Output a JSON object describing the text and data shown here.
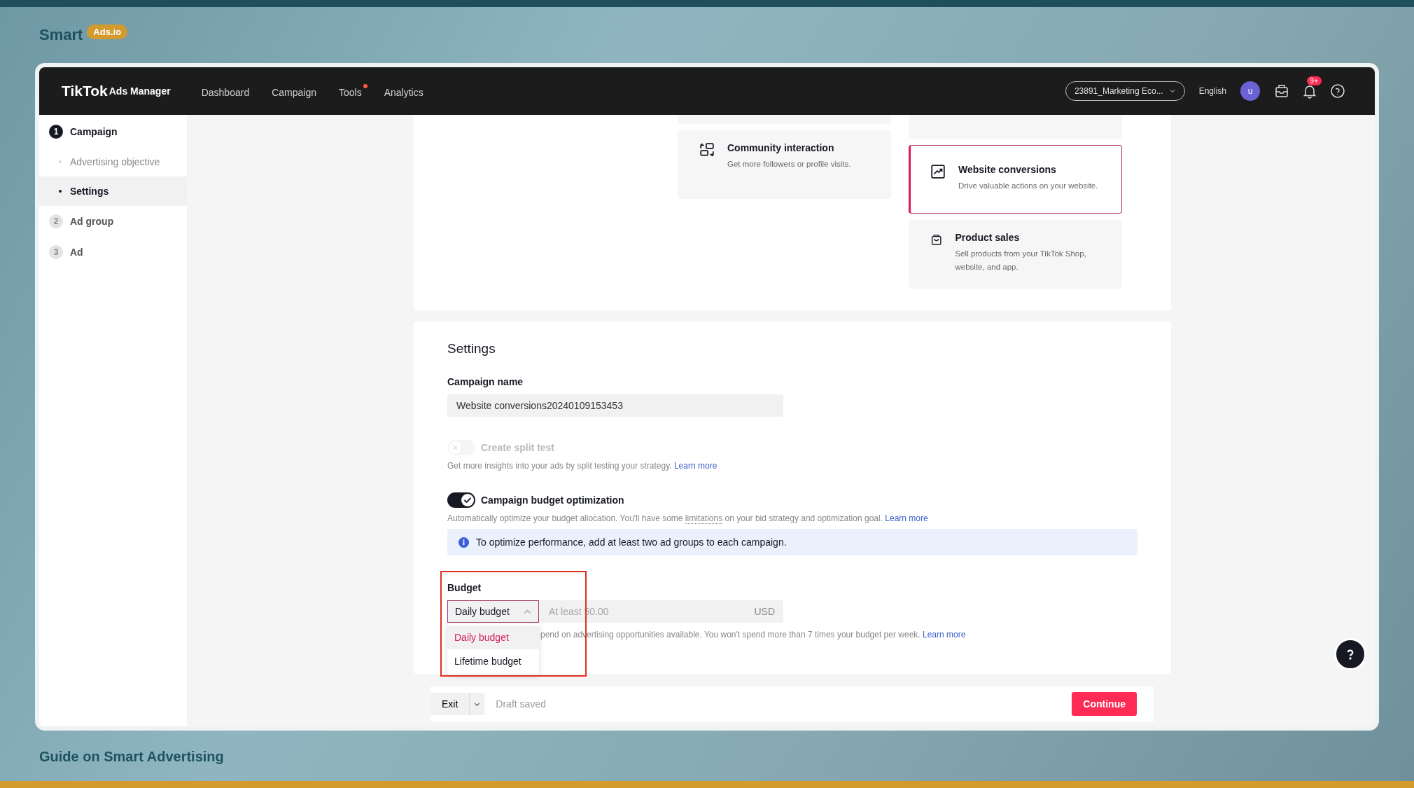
{
  "brand": {
    "name": "Smart",
    "badge": "Ads.io"
  },
  "app": {
    "logo": "TikTok",
    "logo_suffix": "Ads Manager",
    "nav": [
      {
        "label": "Dashboard",
        "dot": false
      },
      {
        "label": "Campaign",
        "dot": false
      },
      {
        "label": "Tools",
        "dot": true
      },
      {
        "label": "Analytics",
        "dot": false
      }
    ],
    "account": "23891_Marketing Eco...",
    "language": "English",
    "avatar": "u",
    "notification_badge": "9+"
  },
  "steps": [
    {
      "number": "1",
      "label": "Campaign",
      "active": true,
      "children": [
        {
          "label": "Advertising objective",
          "selected": false
        },
        {
          "label": "Settings",
          "selected": true
        }
      ]
    },
    {
      "number": "2",
      "label": "Ad group",
      "active": false
    },
    {
      "number": "3",
      "label": "Ad",
      "active": false
    }
  ],
  "objective_columns": [
    [
      {
        "kind": "community",
        "title": "Community interaction",
        "description": "Get more followers or profile visits.",
        "selected": false
      }
    ],
    [
      {
        "kind": "conversions",
        "title": "Website conversions",
        "description": "Drive valuable actions on your website.",
        "selected": true
      },
      {
        "kind": "sales",
        "title": "Product sales",
        "description": "Sell products from your TikTok Shop, website, and app.",
        "selected": false
      }
    ]
  ],
  "settings": {
    "title": "Settings",
    "campaign_name": {
      "label": "Campaign name",
      "value": "Website conversions20240109153453"
    },
    "split_test": {
      "label": "Create split test",
      "on": false,
      "disabled": true,
      "help": "Get more insights into your ads by split testing your strategy.",
      "link": "Learn more"
    },
    "cbo": {
      "label": "Campaign budget optimization",
      "on": true,
      "disabled": false,
      "help_before": "Automatically optimize your budget allocation. You'll have some ",
      "help_term": "limitations",
      "help_after": " on your bid strategy and optimization goal.",
      "link": "Learn more"
    },
    "notice": "To optimize performance, add at least two ad groups to each campaign.",
    "budget": {
      "label": "Budget",
      "type": "Daily budget",
      "expanded": true,
      "highlighted": true,
      "placeholder": "At least 50.00",
      "currency": "USD",
      "help": "pend on advertising opportunities available. You won't spend more than 7 times your budget per week.",
      "link": "Learn more",
      "options": [
        {
          "label": "Daily budget",
          "selected": true
        },
        {
          "label": "Lifetime budget",
          "selected": false
        }
      ]
    }
  },
  "footer": {
    "exit": "Exit",
    "status": "Draft saved",
    "continue": "Continue"
  },
  "caption": "Guide on Smart Advertising"
}
